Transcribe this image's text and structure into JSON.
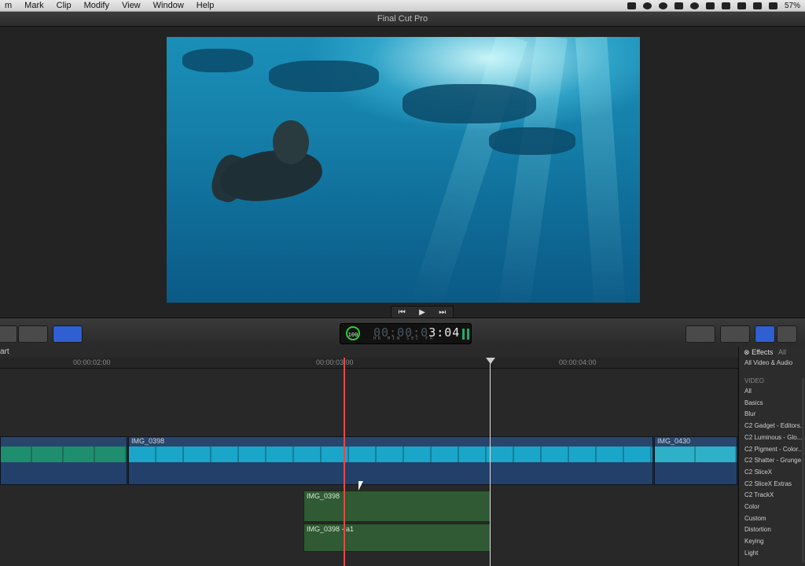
{
  "menubar": {
    "items": [
      "m",
      "Mark",
      "Clip",
      "Modify",
      "View",
      "Window",
      "Help"
    ],
    "battery": "57%"
  },
  "window": {
    "title": "Final Cut Pro"
  },
  "transport": {
    "prev": "⏮",
    "play": "▶",
    "next": "⏭"
  },
  "timecode": {
    "dim": "00:00:0",
    "lit": "3:04",
    "labels": "HR MIN SEC FR",
    "percent": "100"
  },
  "timeline": {
    "header_label": "art",
    "ruler": [
      "00:00:02:00",
      "00:00:03:00",
      "00:00:04:00"
    ],
    "clips": {
      "main": "IMG_0398",
      "right": "IMG_0430",
      "connected": "IMG_0398",
      "audio": "IMG_0398 - a1"
    }
  },
  "effects": {
    "title": "Effects",
    "all": "All",
    "subtitle": "All Video & Audio",
    "category": "VIDEO",
    "items": [
      "All",
      "Basics",
      "Blur",
      "C2 Gadget - Editors..",
      "C2 Luminous - Glo...",
      "C2 Pigment - Color...",
      "C2 Shatter - Grunge...",
      "C2 SliceX",
      "C2 SliceX Extras",
      "C2 TrackX",
      "Color",
      "Custom",
      "Distortion",
      "Keying",
      "Light"
    ]
  }
}
